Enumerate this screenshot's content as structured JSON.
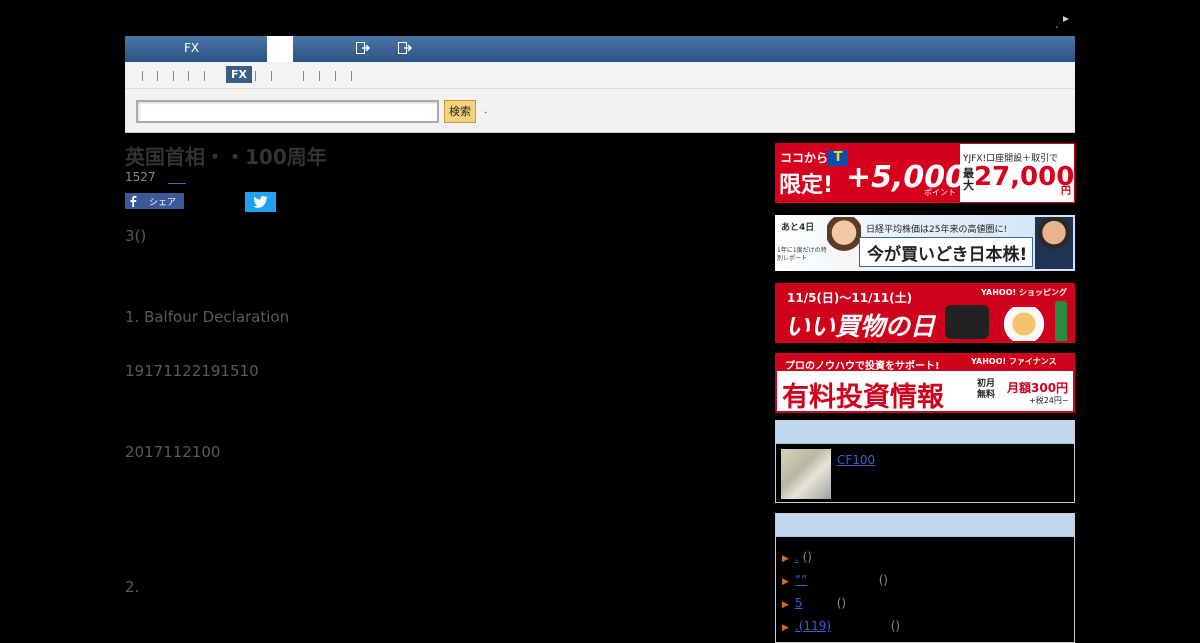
{
  "header": {
    "nav_fx_label": "FX"
  },
  "subnav": {
    "fx_badge": "FX"
  },
  "search": {
    "placeholder": "",
    "button_label": "検索",
    "trailing": "."
  },
  "article": {
    "title": "英国首相・・100周年",
    "meta_count": "1527",
    "share_fb_label": "シェア",
    "paragraphs": [
      "3()",
      "1. Balfour Declaration",
      "19171122191510",
      "2017112100",
      "2."
    ]
  },
  "sidebar": {
    "banners": [
      {
        "line1": "ココから",
        "line2": "限定!",
        "points": "+5,000",
        "unit": "ポイント",
        "right_top": "YJFX!口座開設＋取引で",
        "right_max": "最大",
        "right_amount": "27,000",
        "right_yen": "円"
      },
      {
        "days": "あと4日",
        "sub": "1年に1度だけの特別レポート",
        "top": "日経平均株価は25年来の高値圏に!",
        "main": "今が買いどき日本株!"
      },
      {
        "dates": "11/5(日)～11/11(土)",
        "brand": "YAHOO! ショッピング",
        "main": "いい買物の日"
      },
      {
        "top": "プロのノウハウで投資をサポート!",
        "brand": "YAHOO! ファイナンス",
        "main": "有料投資情報",
        "free": "初月無料",
        "price": "月額300円",
        "tax": "+税24円~"
      }
    ],
    "widget": {
      "link_text": "CF100"
    },
    "ranking": {
      "items": [
        {
          "link": ".",
          "suffix": "()"
        },
        {
          "link": "“”",
          "suffix": "()"
        },
        {
          "link": "5",
          "suffix": "()"
        },
        {
          "link": ".(119)",
          "suffix": "()"
        }
      ]
    }
  },
  "colors": {
    "nav_blue": "#2c5585",
    "fx_badge": "#385e86",
    "search_button": "#f6d27e",
    "box_header": "#c0d8f0",
    "banner1_red": "#d7001c",
    "banner3_red": "#d0021b",
    "link_blue": "#3e5fc8"
  },
  "icons": [
    "cursor-icon",
    "logout-icon",
    "facebook-icon",
    "twitter-icon",
    "bullet-arrow-icon",
    "money-thumbnail"
  ]
}
